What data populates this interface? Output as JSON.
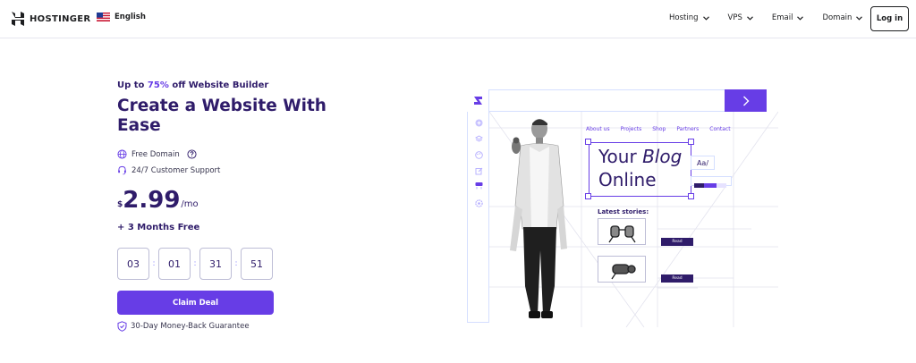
{
  "header": {
    "brand": "HOSTINGER",
    "language": "English",
    "nav": [
      {
        "label": "Hosting"
      },
      {
        "label": "VPS"
      },
      {
        "label": "Email"
      },
      {
        "label": "Domain"
      }
    ],
    "login_label": "Log in"
  },
  "hero": {
    "promo_prefix": "Up to ",
    "promo_accent": "75%",
    "promo_suffix": " off Website Builder",
    "headline": "Create a Website With Ease",
    "features": [
      {
        "label": "Free Domain",
        "icon": "globe-icon",
        "extra_icon": "help-circle-icon"
      },
      {
        "label": "24/7 Customer Support",
        "icon": "headset-icon"
      }
    ],
    "price": {
      "currency": "$",
      "amount": "2.99",
      "period": "/mo"
    },
    "bonus": "+ 3 Months Free",
    "timer": [
      "03",
      "01",
      "31",
      "51"
    ],
    "cta_label": "Claim Deal",
    "guarantee": "30-Day Money-Back Guarantee"
  },
  "illustration": {
    "site_nav": [
      "About us",
      "Projects",
      "Shop",
      "Partners",
      "Contact"
    ],
    "blog_title_1": "Your ",
    "blog_title_em": "Blog",
    "blog_title_2": "Online",
    "font_picker": "Aa/",
    "latest_label": "Latest stories:",
    "read_label": "Read"
  },
  "colors": {
    "accent": "#673de6",
    "dark": "#2f1c6a",
    "border": "#d5dfff"
  }
}
